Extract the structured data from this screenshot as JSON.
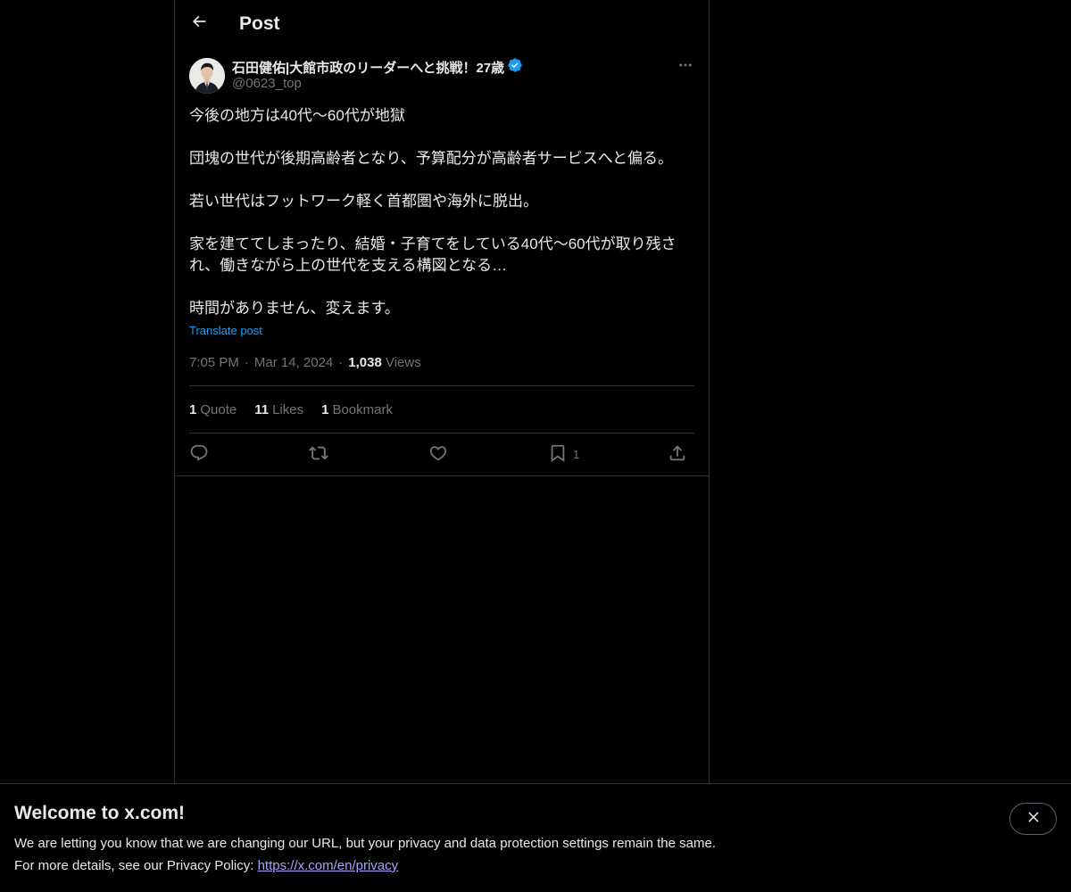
{
  "header": {
    "title": "Post",
    "back_icon": "arrow-left-icon"
  },
  "author": {
    "name": "石田健佑|大館市政のリーダーへと挑戦！27歳",
    "handle": "@0623_top",
    "verified": true,
    "verified_color": "#1d9bf0"
  },
  "post": {
    "lines": [
      "今後の地方は40代〜60代が地獄",
      "",
      "団塊の世代が後期高齢者となり、予算配分が高齢者サービスへと偏る。",
      "",
      "若い世代はフットワーク軽く首都圏や海外に脱出。",
      "",
      "家を建ててしまったり、結婚・子育てをしている40代〜60代が取り残さ",
      "れ、働きながら上の世代を支える構図となる…",
      "",
      "時間がありません、変えます。"
    ],
    "translate_label": "Translate post"
  },
  "meta": {
    "time": "7:05 PM",
    "separator": "·",
    "date": "Mar 14, 2024",
    "views_count": "1,038",
    "views_label": "Views"
  },
  "stats": {
    "quotes_count": "1",
    "quotes_label": "Quote",
    "likes_count": "11",
    "likes_label": "Likes",
    "bookmarks_count": "1",
    "bookmarks_label": "Bookmark"
  },
  "actions": {
    "reply_icon": "reply-icon",
    "repost_icon": "repost-icon",
    "like_icon": "heart-icon",
    "bookmark_icon": "bookmark-icon",
    "bookmark_count": "1",
    "share_icon": "share-icon"
  },
  "banner": {
    "title": "Welcome to x.com!",
    "line1": "We are letting you know that we are changing our URL, but your privacy and data protection settings remain the same.",
    "line2_prefix": "For more details, see our Privacy Policy: ",
    "line2_link": "https://x.com/en/privacy",
    "close_icon": "close-icon"
  },
  "colors": {
    "background": "#000000",
    "text": "#e7e9ea",
    "muted": "#71767b",
    "accent": "#1d9bf0",
    "border": "#2f3336",
    "link": "#a8a4ff"
  }
}
